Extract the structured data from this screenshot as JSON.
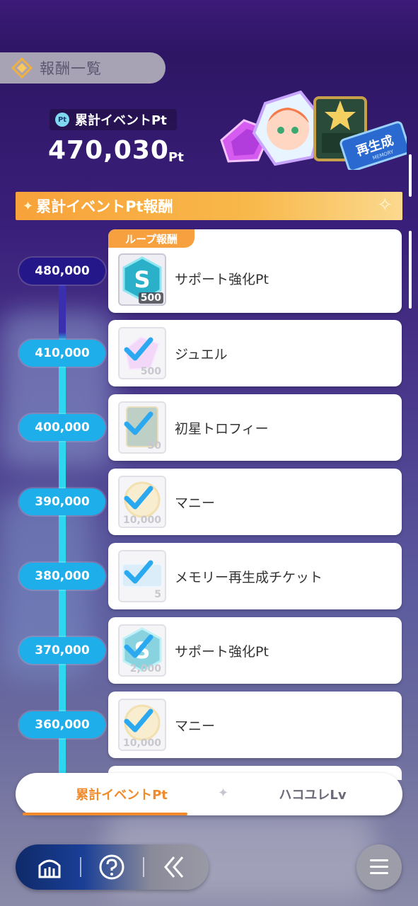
{
  "header": {
    "title": "報酬一覧"
  },
  "event_points": {
    "badge": "Pt",
    "label": "累計イベントPt",
    "total": "470,030",
    "unit": "Pt"
  },
  "featured_rewards": {
    "ticket_text": "再生成",
    "ticket_subtext": "MEMORY"
  },
  "section": {
    "title": "累計イベントPt報酬"
  },
  "loop_tag": "ループ報酬",
  "rewards": [
    {
      "threshold": "480,000",
      "name": "サポート強化Pt",
      "qty": "500",
      "claimed": false,
      "current": true,
      "icon": "support-pt-icon"
    },
    {
      "threshold": "410,000",
      "name": "ジュエル",
      "qty": "500",
      "claimed": true,
      "current": false,
      "icon": "jewel-icon"
    },
    {
      "threshold": "400,000",
      "name": "初星トロフィー",
      "qty": "50",
      "claimed": true,
      "current": false,
      "icon": "trophy-icon"
    },
    {
      "threshold": "390,000",
      "name": "マニー",
      "qty": "10,000",
      "claimed": true,
      "current": false,
      "icon": "money-icon"
    },
    {
      "threshold": "380,000",
      "name": "メモリー再生成チケット",
      "qty": "5",
      "claimed": true,
      "current": false,
      "icon": "memory-ticket-icon"
    },
    {
      "threshold": "370,000",
      "name": "サポート強化Pt",
      "qty": "2,000",
      "claimed": true,
      "current": false,
      "icon": "support-pt-icon"
    },
    {
      "threshold": "360,000",
      "name": "マニー",
      "qty": "10,000",
      "claimed": true,
      "current": false,
      "icon": "money-icon"
    }
  ],
  "tabs": [
    {
      "label": "累計イベントPt",
      "active": true
    },
    {
      "label": "ハコユレLv",
      "active": false
    }
  ],
  "support_icon_letter": "S",
  "colors": {
    "accent_orange": "#f08a2a",
    "threshold_blue": "#1eaeea",
    "threshold_current": "#23178a",
    "check_blue": "#2aa8f0"
  }
}
